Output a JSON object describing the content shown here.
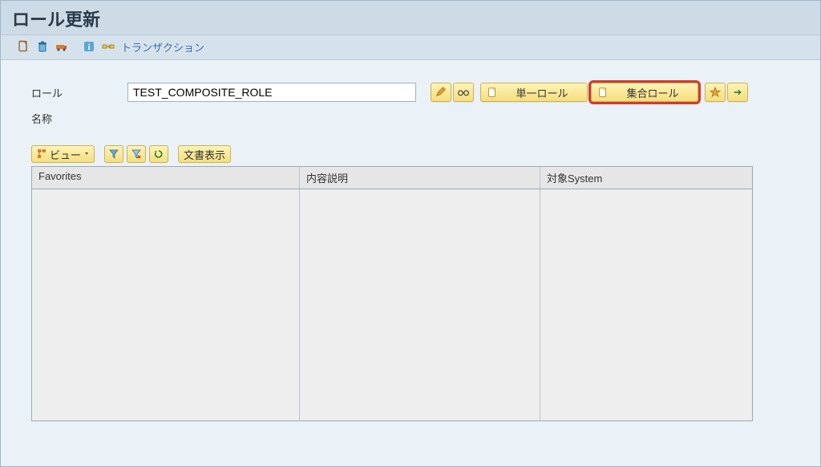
{
  "window": {
    "title": "ロール更新"
  },
  "apptoolbar": {
    "transaction_label": "トランザクション"
  },
  "form": {
    "role_label": "ロール",
    "role_value": "TEST_COMPOSITE_ROLE",
    "name_label": "名称",
    "name_value": ""
  },
  "buttons": {
    "single_role": "単一ロール",
    "composite_role": "集合ロール"
  },
  "table_toolbar": {
    "view_label": "ビュー",
    "doc_display_label": "文書表示"
  },
  "grid": {
    "columns": [
      "Favorites",
      "内容説明",
      "対象System"
    ]
  }
}
